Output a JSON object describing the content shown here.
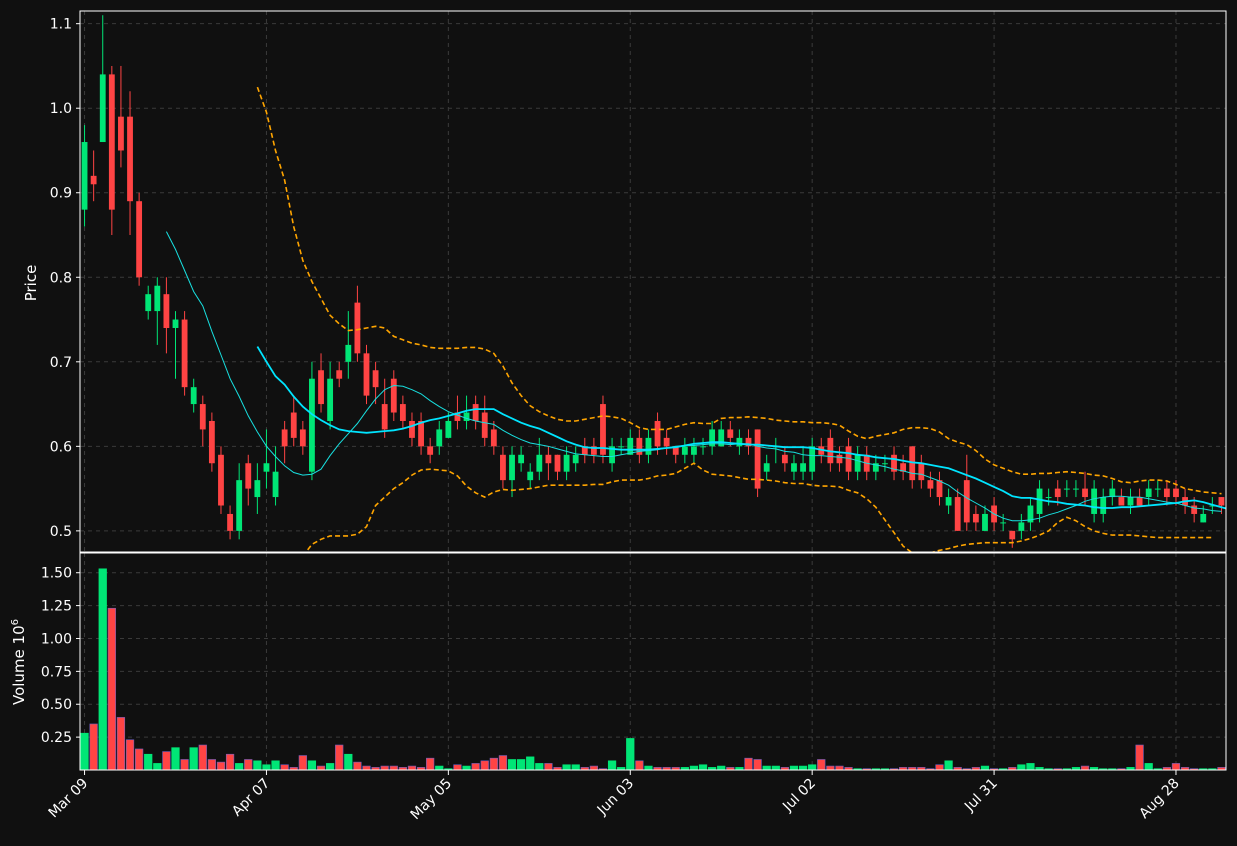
{
  "chart_data": {
    "type": "candlestick",
    "theme": {
      "background": "#101010",
      "grid": "#3a3a3a",
      "text": "#ffffff",
      "up_color": "#00e676",
      "down_color": "#ff4444",
      "sma_fast_color": "#18e0e0",
      "sma_slow_color": "#00e5ff",
      "band_color": "#ffa500"
    },
    "price_panel": {
      "ylabel": "Price",
      "ylim": [
        0.475,
        1.115
      ],
      "yticks": [
        "0.5",
        "0.6",
        "0.7",
        "0.8",
        "0.9",
        "1.0",
        "1.1"
      ],
      "grid": true
    },
    "volume_panel": {
      "ylabel": "Volume",
      "yunit": "10^6",
      "ylim": [
        0,
        1.65
      ],
      "yticks": [
        "0.25",
        "0.50",
        "0.75",
        "1.00",
        "1.25",
        "1.50"
      ],
      "grid": true
    },
    "xlim": [
      -0.5,
      125.5
    ],
    "xticks": [
      {
        "index": 0,
        "label": "Mar 09"
      },
      {
        "index": 20,
        "label": "Apr 07"
      },
      {
        "index": 40,
        "label": "May 05"
      },
      {
        "index": 60,
        "label": "Jun 03"
      },
      {
        "index": 80,
        "label": "Jul 02"
      },
      {
        "index": 100,
        "label": "Jul 31"
      },
      {
        "index": 120,
        "label": "Aug 28"
      }
    ],
    "bars": [
      [
        0.88,
        0.96,
        0.86,
        0.98,
        0.28
      ],
      [
        0.92,
        0.91,
        0.89,
        0.95,
        0.35
      ],
      [
        0.96,
        1.04,
        0.96,
        1.11,
        1.53
      ],
      [
        1.04,
        0.88,
        0.85,
        1.05,
        1.23
      ],
      [
        0.99,
        0.95,
        0.93,
        1.05,
        0.4
      ],
      [
        0.99,
        0.89,
        0.85,
        1.02,
        0.23
      ],
      [
        0.89,
        0.8,
        0.79,
        0.9,
        0.16
      ],
      [
        0.76,
        0.78,
        0.75,
        0.79,
        0.12
      ],
      [
        0.76,
        0.79,
        0.72,
        0.8,
        0.05
      ],
      [
        0.78,
        0.74,
        0.71,
        0.8,
        0.14
      ],
      [
        0.74,
        0.75,
        0.68,
        0.76,
        0.17
      ],
      [
        0.75,
        0.67,
        0.66,
        0.76,
        0.08
      ],
      [
        0.65,
        0.67,
        0.64,
        0.68,
        0.17
      ],
      [
        0.65,
        0.62,
        0.6,
        0.66,
        0.19
      ],
      [
        0.63,
        0.58,
        0.57,
        0.64,
        0.08
      ],
      [
        0.59,
        0.53,
        0.52,
        0.6,
        0.06
      ],
      [
        0.52,
        0.5,
        0.49,
        0.53,
        0.12
      ],
      [
        0.5,
        0.56,
        0.49,
        0.58,
        0.05
      ],
      [
        0.58,
        0.55,
        0.53,
        0.59,
        0.08
      ],
      [
        0.54,
        0.56,
        0.52,
        0.58,
        0.07
      ],
      [
        0.57,
        0.58,
        0.55,
        0.62,
        0.04
      ],
      [
        0.54,
        0.57,
        0.53,
        0.6,
        0.07
      ],
      [
        0.62,
        0.6,
        0.58,
        0.63,
        0.04
      ],
      [
        0.64,
        0.61,
        0.6,
        0.66,
        0.02
      ],
      [
        0.62,
        0.6,
        0.59,
        0.63,
        0.11
      ],
      [
        0.57,
        0.68,
        0.56,
        0.7,
        0.07
      ],
      [
        0.69,
        0.65,
        0.64,
        0.71,
        0.03
      ],
      [
        0.63,
        0.68,
        0.62,
        0.7,
        0.05
      ],
      [
        0.69,
        0.68,
        0.67,
        0.7,
        0.19
      ],
      [
        0.7,
        0.72,
        0.68,
        0.76,
        0.12
      ],
      [
        0.77,
        0.71,
        0.7,
        0.79,
        0.06
      ],
      [
        0.71,
        0.66,
        0.65,
        0.72,
        0.03
      ],
      [
        0.69,
        0.67,
        0.65,
        0.7,
        0.02
      ],
      [
        0.65,
        0.62,
        0.61,
        0.68,
        0.03
      ],
      [
        0.68,
        0.64,
        0.63,
        0.69,
        0.03
      ],
      [
        0.65,
        0.63,
        0.62,
        0.66,
        0.02
      ],
      [
        0.63,
        0.61,
        0.6,
        0.64,
        0.03
      ],
      [
        0.63,
        0.6,
        0.59,
        0.64,
        0.02
      ],
      [
        0.6,
        0.59,
        0.58,
        0.61,
        0.09
      ],
      [
        0.6,
        0.62,
        0.59,
        0.63,
        0.03
      ],
      [
        0.61,
        0.63,
        0.61,
        0.64,
        0.01
      ],
      [
        0.64,
        0.63,
        0.62,
        0.66,
        0.04
      ],
      [
        0.63,
        0.64,
        0.62,
        0.66,
        0.03
      ],
      [
        0.65,
        0.63,
        0.62,
        0.66,
        0.05
      ],
      [
        0.64,
        0.61,
        0.6,
        0.66,
        0.07
      ],
      [
        0.62,
        0.6,
        0.59,
        0.63,
        0.09
      ],
      [
        0.59,
        0.56,
        0.55,
        0.6,
        0.11
      ],
      [
        0.56,
        0.59,
        0.54,
        0.6,
        0.08
      ],
      [
        0.58,
        0.59,
        0.57,
        0.6,
        0.08
      ],
      [
        0.56,
        0.57,
        0.55,
        0.58,
        0.1
      ],
      [
        0.57,
        0.59,
        0.56,
        0.61,
        0.05
      ],
      [
        0.59,
        0.58,
        0.56,
        0.6,
        0.05
      ],
      [
        0.59,
        0.57,
        0.56,
        0.59,
        0.02
      ],
      [
        0.57,
        0.59,
        0.56,
        0.6,
        0.04
      ],
      [
        0.58,
        0.59,
        0.57,
        0.6,
        0.04
      ],
      [
        0.6,
        0.59,
        0.58,
        0.61,
        0.02
      ],
      [
        0.6,
        0.59,
        0.58,
        0.61,
        0.03
      ],
      [
        0.65,
        0.59,
        0.58,
        0.66,
        0.01
      ],
      [
        0.58,
        0.6,
        0.57,
        0.61,
        0.07
      ],
      [
        0.6,
        0.6,
        0.59,
        0.61,
        0.02
      ],
      [
        0.59,
        0.61,
        0.59,
        0.62,
        0.24
      ],
      [
        0.61,
        0.59,
        0.58,
        0.62,
        0.07
      ],
      [
        0.59,
        0.61,
        0.58,
        0.62,
        0.03
      ],
      [
        0.63,
        0.6,
        0.59,
        0.64,
        0.02
      ],
      [
        0.61,
        0.6,
        0.59,
        0.62,
        0.02
      ],
      [
        0.6,
        0.59,
        0.58,
        0.6,
        0.02
      ],
      [
        0.59,
        0.6,
        0.58,
        0.61,
        0.02
      ],
      [
        0.59,
        0.6,
        0.58,
        0.61,
        0.03
      ],
      [
        0.6,
        0.6,
        0.59,
        0.61,
        0.04
      ],
      [
        0.6,
        0.62,
        0.59,
        0.63,
        0.02
      ],
      [
        0.6,
        0.62,
        0.6,
        0.63,
        0.03
      ],
      [
        0.62,
        0.61,
        0.6,
        0.63,
        0.02
      ],
      [
        0.6,
        0.61,
        0.59,
        0.62,
        0.02
      ],
      [
        0.61,
        0.6,
        0.59,
        0.62,
        0.09
      ],
      [
        0.62,
        0.55,
        0.54,
        0.62,
        0.08
      ],
      [
        0.57,
        0.58,
        0.56,
        0.59,
        0.03
      ],
      [
        0.6,
        0.6,
        0.58,
        0.61,
        0.03
      ],
      [
        0.59,
        0.58,
        0.57,
        0.6,
        0.02
      ],
      [
        0.57,
        0.58,
        0.56,
        0.59,
        0.03
      ],
      [
        0.57,
        0.58,
        0.56,
        0.6,
        0.03
      ],
      [
        0.57,
        0.6,
        0.56,
        0.61,
        0.04
      ],
      [
        0.6,
        0.59,
        0.58,
        0.61,
        0.08
      ],
      [
        0.61,
        0.58,
        0.57,
        0.62,
        0.03
      ],
      [
        0.59,
        0.58,
        0.57,
        0.6,
        0.03
      ],
      [
        0.6,
        0.57,
        0.56,
        0.61,
        0.02
      ],
      [
        0.57,
        0.59,
        0.56,
        0.6,
        0.01
      ],
      [
        0.59,
        0.57,
        0.56,
        0.6,
        0.01
      ],
      [
        0.57,
        0.58,
        0.56,
        0.59,
        0.01
      ],
      [
        0.58,
        0.58,
        0.57,
        0.59,
        0.01
      ],
      [
        0.59,
        0.57,
        0.56,
        0.6,
        0.01
      ],
      [
        0.58,
        0.57,
        0.56,
        0.59,
        0.02
      ],
      [
        0.6,
        0.56,
        0.55,
        0.6,
        0.02
      ],
      [
        0.58,
        0.56,
        0.55,
        0.59,
        0.02
      ],
      [
        0.56,
        0.55,
        0.54,
        0.57,
        0.01
      ],
      [
        0.56,
        0.54,
        0.53,
        0.57,
        0.04
      ],
      [
        0.53,
        0.54,
        0.52,
        0.55,
        0.07
      ],
      [
        0.54,
        0.5,
        0.5,
        0.55,
        0.02
      ],
      [
        0.56,
        0.51,
        0.5,
        0.59,
        0.01
      ],
      [
        0.52,
        0.51,
        0.5,
        0.53,
        0.02
      ],
      [
        0.5,
        0.52,
        0.5,
        0.53,
        0.03
      ],
      [
        0.53,
        0.51,
        0.5,
        0.54,
        0.01
      ],
      [
        0.51,
        0.51,
        0.5,
        0.52,
        0.01
      ],
      [
        0.5,
        0.49,
        0.48,
        0.5,
        0.02
      ],
      [
        0.5,
        0.51,
        0.49,
        0.52,
        0.04
      ],
      [
        0.51,
        0.53,
        0.5,
        0.54,
        0.05
      ],
      [
        0.52,
        0.55,
        0.51,
        0.56,
        0.02
      ],
      [
        0.54,
        0.54,
        0.53,
        0.55,
        0.01
      ],
      [
        0.55,
        0.54,
        0.53,
        0.56,
        0.01
      ],
      [
        0.55,
        0.55,
        0.54,
        0.56,
        0.01
      ],
      [
        0.55,
        0.55,
        0.54,
        0.56,
        0.02
      ],
      [
        0.55,
        0.54,
        0.53,
        0.57,
        0.03
      ],
      [
        0.52,
        0.55,
        0.51,
        0.56,
        0.02
      ],
      [
        0.52,
        0.54,
        0.51,
        0.55,
        0.01
      ],
      [
        0.54,
        0.55,
        0.53,
        0.56,
        0.01
      ],
      [
        0.54,
        0.53,
        0.53,
        0.55,
        0.01
      ],
      [
        0.53,
        0.54,
        0.52,
        0.55,
        0.02
      ],
      [
        0.54,
        0.53,
        0.53,
        0.55,
        0.19
      ],
      [
        0.54,
        0.55,
        0.53,
        0.56,
        0.05
      ],
      [
        0.55,
        0.55,
        0.54,
        0.56,
        0.01
      ],
      [
        0.55,
        0.54,
        0.53,
        0.56,
        0.02
      ],
      [
        0.55,
        0.54,
        0.53,
        0.56,
        0.05
      ],
      [
        0.54,
        0.53,
        0.52,
        0.55,
        0.02
      ],
      [
        0.53,
        0.52,
        0.51,
        0.54,
        0.01
      ],
      [
        0.51,
        0.52,
        0.51,
        0.53,
        0.01
      ],
      [
        0.53,
        0.53,
        0.52,
        0.54,
        0.01
      ],
      [
        0.54,
        0.53,
        0.52,
        0.54,
        0.02
      ]
    ],
    "sma_fast": [
      null,
      null,
      null,
      null,
      null,
      null,
      null,
      null,
      null,
      0.854,
      0.833,
      0.808,
      0.783,
      0.766,
      0.736,
      0.708,
      0.68,
      0.659,
      0.636,
      0.617,
      0.6,
      0.588,
      0.577,
      0.569,
      0.566,
      0.567,
      0.573,
      0.589,
      0.603,
      0.615,
      0.627,
      0.642,
      0.656,
      0.667,
      0.672,
      0.671,
      0.667,
      0.662,
      0.654,
      0.647,
      0.641,
      0.637,
      0.633,
      0.63,
      0.628,
      0.626,
      0.619,
      0.613,
      0.608,
      0.604,
      0.602,
      0.6,
      0.597,
      0.594,
      0.591,
      0.59,
      0.589,
      0.588,
      0.588,
      0.59,
      0.592,
      0.594,
      0.595,
      0.596,
      0.598,
      0.6,
      0.601,
      0.601,
      0.602,
      0.603,
      0.603,
      0.602,
      0.603,
      0.603,
      0.6,
      0.598,
      0.597,
      0.594,
      0.593,
      0.59,
      0.589,
      0.589,
      0.588,
      0.587,
      0.586,
      0.583,
      0.58,
      0.578,
      0.576,
      0.573,
      0.571,
      0.568,
      0.567,
      0.563,
      0.559,
      0.554,
      0.546,
      0.539,
      0.533,
      0.527,
      0.52,
      0.515,
      0.512,
      0.512,
      0.513,
      0.515,
      0.519,
      0.522,
      0.526,
      0.53,
      0.535,
      0.538,
      0.54,
      0.541,
      0.541,
      0.54,
      0.54,
      0.538,
      0.536,
      0.534,
      0.533,
      0.53,
      0.527,
      0.526,
      0.524,
      0.523
    ],
    "sma_slow": [
      null,
      null,
      null,
      null,
      null,
      null,
      null,
      null,
      null,
      null,
      null,
      null,
      null,
      null,
      null,
      null,
      null,
      null,
      null,
      0.718,
      0.7,
      0.683,
      0.673,
      0.659,
      0.647,
      0.638,
      0.631,
      0.625,
      0.62,
      0.618,
      0.617,
      0.616,
      0.617,
      0.618,
      0.619,
      0.621,
      0.624,
      0.628,
      0.631,
      0.633,
      0.636,
      0.639,
      0.642,
      0.644,
      0.644,
      0.644,
      0.638,
      0.633,
      0.628,
      0.624,
      0.621,
      0.616,
      0.611,
      0.606,
      0.602,
      0.599,
      0.598,
      0.598,
      0.597,
      0.596,
      0.596,
      0.596,
      0.596,
      0.597,
      0.598,
      0.599,
      0.601,
      0.603,
      0.604,
      0.605,
      0.605,
      0.604,
      0.603,
      0.602,
      0.602,
      0.601,
      0.6,
      0.599,
      0.599,
      0.599,
      0.598,
      0.596,
      0.594,
      0.593,
      0.592,
      0.59,
      0.589,
      0.587,
      0.586,
      0.585,
      0.583,
      0.581,
      0.58,
      0.578,
      0.576,
      0.574,
      0.57,
      0.566,
      0.562,
      0.557,
      0.552,
      0.547,
      0.541,
      0.539,
      0.539,
      0.537,
      0.535,
      0.534,
      0.532,
      0.531,
      0.53,
      0.528,
      0.527,
      0.527,
      0.528,
      0.528,
      0.529,
      0.53,
      0.531,
      0.532,
      0.533,
      0.535,
      0.536,
      0.534,
      0.531,
      0.528,
      0.525,
      0.523
    ],
    "band_upper": [
      null,
      null,
      null,
      null,
      null,
      null,
      null,
      null,
      null,
      null,
      null,
      null,
      null,
      null,
      null,
      null,
      null,
      null,
      null,
      1.025,
      0.995,
      0.95,
      0.915,
      0.86,
      0.82,
      0.795,
      0.775,
      0.755,
      0.745,
      0.737,
      0.738,
      0.74,
      0.742,
      0.74,
      0.73,
      0.726,
      0.722,
      0.72,
      0.717,
      0.716,
      0.716,
      0.716,
      0.717,
      0.717,
      0.715,
      0.71,
      0.695,
      0.675,
      0.66,
      0.648,
      0.641,
      0.636,
      0.632,
      0.63,
      0.63,
      0.632,
      0.634,
      0.636,
      0.635,
      0.633,
      0.628,
      0.622,
      0.62,
      0.62,
      0.62,
      0.623,
      0.626,
      0.628,
      0.627,
      0.627,
      0.633,
      0.634,
      0.634,
      0.635,
      0.634,
      0.633,
      0.631,
      0.63,
      0.629,
      0.629,
      0.628,
      0.628,
      0.627,
      0.625,
      0.618,
      0.612,
      0.609,
      0.612,
      0.614,
      0.616,
      0.62,
      0.622,
      0.622,
      0.621,
      0.617,
      0.609,
      0.605,
      0.602,
      0.595,
      0.585,
      0.578,
      0.574,
      0.57,
      0.567,
      0.567,
      0.568,
      0.568,
      0.569,
      0.57,
      0.569,
      0.568,
      0.566,
      0.565,
      0.562,
      0.558,
      0.557,
      0.559,
      0.56,
      0.56,
      0.559,
      0.555,
      0.55,
      0.548,
      0.546,
      0.545,
      0.544
    ],
    "band_lower": [
      null,
      null,
      null,
      null,
      null,
      null,
      null,
      null,
      null,
      null,
      null,
      null,
      null,
      null,
      null,
      null,
      null,
      null,
      null,
      null,
      null,
      null,
      null,
      null,
      0.47,
      0.484,
      0.49,
      0.494,
      0.494,
      0.494,
      0.496,
      0.505,
      0.53,
      0.54,
      0.55,
      0.557,
      0.566,
      0.572,
      0.573,
      0.572,
      0.571,
      0.565,
      0.553,
      0.545,
      0.54,
      0.546,
      0.549,
      0.548,
      0.549,
      0.55,
      0.552,
      0.554,
      0.554,
      0.554,
      0.554,
      0.554,
      0.555,
      0.555,
      0.558,
      0.56,
      0.56,
      0.56,
      0.562,
      0.565,
      0.566,
      0.568,
      0.574,
      0.58,
      0.572,
      0.567,
      0.566,
      0.565,
      0.563,
      0.561,
      0.561,
      0.56,
      0.559,
      0.557,
      0.556,
      0.556,
      0.554,
      0.553,
      0.553,
      0.552,
      0.548,
      0.545,
      0.538,
      0.528,
      0.513,
      0.498,
      0.482,
      0.474,
      0.473,
      0.474,
      0.477,
      0.479,
      0.482,
      0.484,
      0.485,
      0.486,
      0.486,
      0.486,
      0.486,
      0.488,
      0.491,
      0.495,
      0.5,
      0.51,
      0.516,
      0.512,
      0.505,
      0.5,
      0.497,
      0.495,
      0.495,
      0.495,
      0.494,
      0.493,
      0.492,
      0.492,
      0.492,
      0.492,
      0.492,
      0.492,
      0.492
    ]
  }
}
